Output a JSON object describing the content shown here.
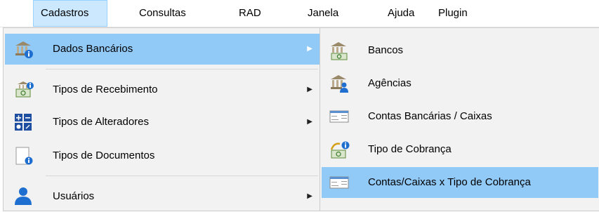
{
  "menubar": {
    "items": [
      {
        "label": "Cadastros",
        "active": true
      },
      {
        "label": "Consultas"
      },
      {
        "label": "RAD"
      },
      {
        "label": "Janela"
      },
      {
        "label": "Ajuda"
      },
      {
        "label": "Plugin"
      }
    ]
  },
  "cadastros_menu": {
    "items": [
      {
        "label": "Dados Bancários",
        "icon": "bank-info-icon",
        "submenu": true,
        "highlighted": true
      },
      {
        "label": "Tipos de Recebimento",
        "icon": "receipt-types-icon",
        "submenu": true
      },
      {
        "label": "Tipos de Alteradores",
        "icon": "calculator-info-icon",
        "submenu": true
      },
      {
        "label": "Tipos de Documentos",
        "icon": "document-info-icon",
        "submenu": false
      },
      {
        "label": "Usuários",
        "icon": "user-icon",
        "submenu": true
      }
    ]
  },
  "dados_bancarios_submenu": {
    "items": [
      {
        "label": "Bancos",
        "icon": "bank-icon"
      },
      {
        "label": "Agências",
        "icon": "agency-icon"
      },
      {
        "label": "Contas Bancárias / Caixas",
        "icon": "check-icon"
      },
      {
        "label": "Tipo de Cobrança",
        "icon": "collection-type-icon"
      },
      {
        "label": "Contas/Caixas x Tipo de Cobrança",
        "icon": "check-icon",
        "highlighted": true
      }
    ]
  },
  "colors": {
    "menubar_active_bg": "#cce8ff",
    "menu_bg": "#f2f2f2",
    "highlight_bg": "#91c9f7",
    "info_blue": "#1f6fd1"
  }
}
